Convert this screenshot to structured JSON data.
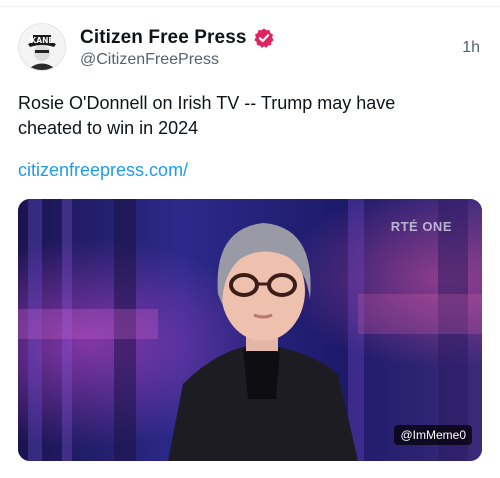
{
  "post": {
    "author": {
      "display_name": "Citizen Free Press",
      "handle": "@CitizenFreePress",
      "verified": true,
      "avatar_text": "KANE",
      "badge_color": "#e0245e"
    },
    "timestamp": "1h",
    "text": "Rosie O'Donnell on Irish TV -- Trump may have cheated to win in 2024",
    "link": "citizenfreepress.com/",
    "media": {
      "channel_logo": "RTÉ ONE",
      "watermark": "@ImMeme0"
    }
  },
  "colors": {
    "link": "#1d9bf0",
    "secondary_text": "#536471",
    "primary_text": "#0f1419"
  }
}
